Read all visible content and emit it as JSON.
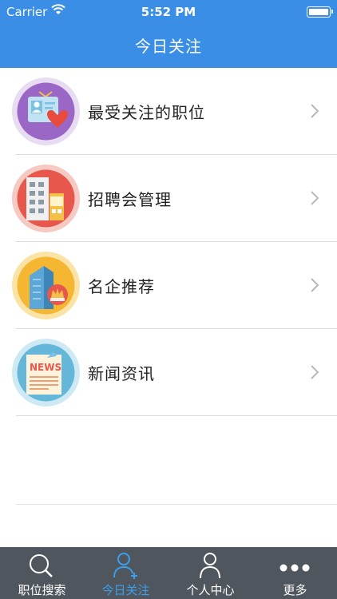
{
  "status_bar": {
    "carrier": "Carrier",
    "time": "5:52 PM"
  },
  "nav": {
    "title": "今日关注"
  },
  "list": {
    "items": [
      {
        "label": "最受关注的职位",
        "icon": "id-card-heart-icon"
      },
      {
        "label": "招聘会管理",
        "icon": "building-icon"
      },
      {
        "label": "名企推荐",
        "icon": "skyscraper-badge-icon"
      },
      {
        "label": "新闻资讯",
        "icon": "newspaper-icon"
      }
    ]
  },
  "tabbar": {
    "active": "今日关注",
    "tabs": [
      {
        "label": "职位搜索",
        "icon": "search-icon"
      },
      {
        "label": "今日关注",
        "icon": "user-plus-icon"
      },
      {
        "label": "个人中心",
        "icon": "user-icon"
      },
      {
        "label": "更多",
        "icon": "more-dots-icon"
      }
    ]
  },
  "colors": {
    "nav_bg": "#3a8ee6",
    "tabbar_bg": "#50565e",
    "tab_active": "#3aa0ee"
  }
}
